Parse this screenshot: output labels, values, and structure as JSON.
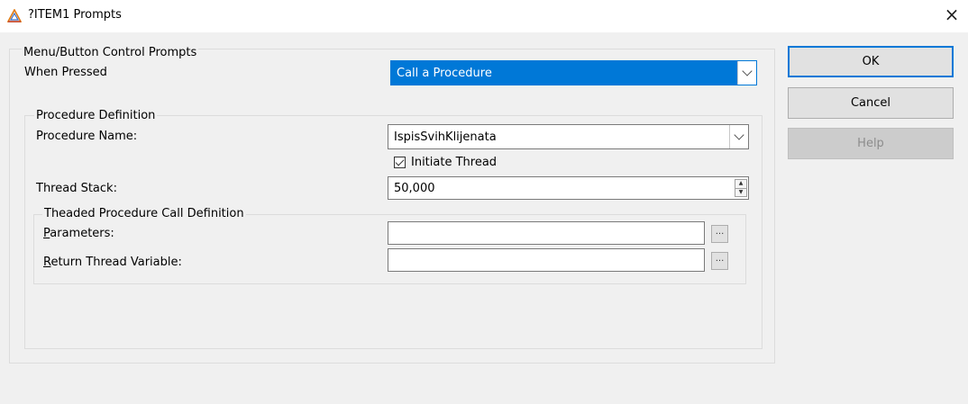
{
  "window": {
    "title": "?ITEM1 Prompts",
    "close_glyph": "×",
    "icon": "triangle-app-icon"
  },
  "prompts_group": {
    "label": "Menu/Button Control Prompts",
    "when_pressed": {
      "label": "When Pressed",
      "value": "Call a Procedure"
    }
  },
  "procedure_group": {
    "label": "Procedure Definition",
    "procedure_name": {
      "label": "Procedure Name:",
      "value": "IspisSvihKlijenata"
    },
    "initiate_thread": {
      "label": "Initiate Thread",
      "checked": true
    },
    "thread_stack": {
      "label": "Thread Stack:",
      "value": "50,000"
    }
  },
  "threaded_group": {
    "label": "Theaded Procedure Call Definition",
    "parameters": {
      "label_mnemonic": "P",
      "label_rest": "arameters:",
      "value": ""
    },
    "return_variable": {
      "label_mnemonic": "R",
      "label_rest": "eturn Thread Variable:",
      "value": ""
    },
    "ellipsis": "..."
  },
  "buttons": {
    "ok": "OK",
    "cancel": "Cancel",
    "help": "Help"
  },
  "colors": {
    "accent": "#0078d7",
    "dialog_bg": "#f0f0f0"
  }
}
